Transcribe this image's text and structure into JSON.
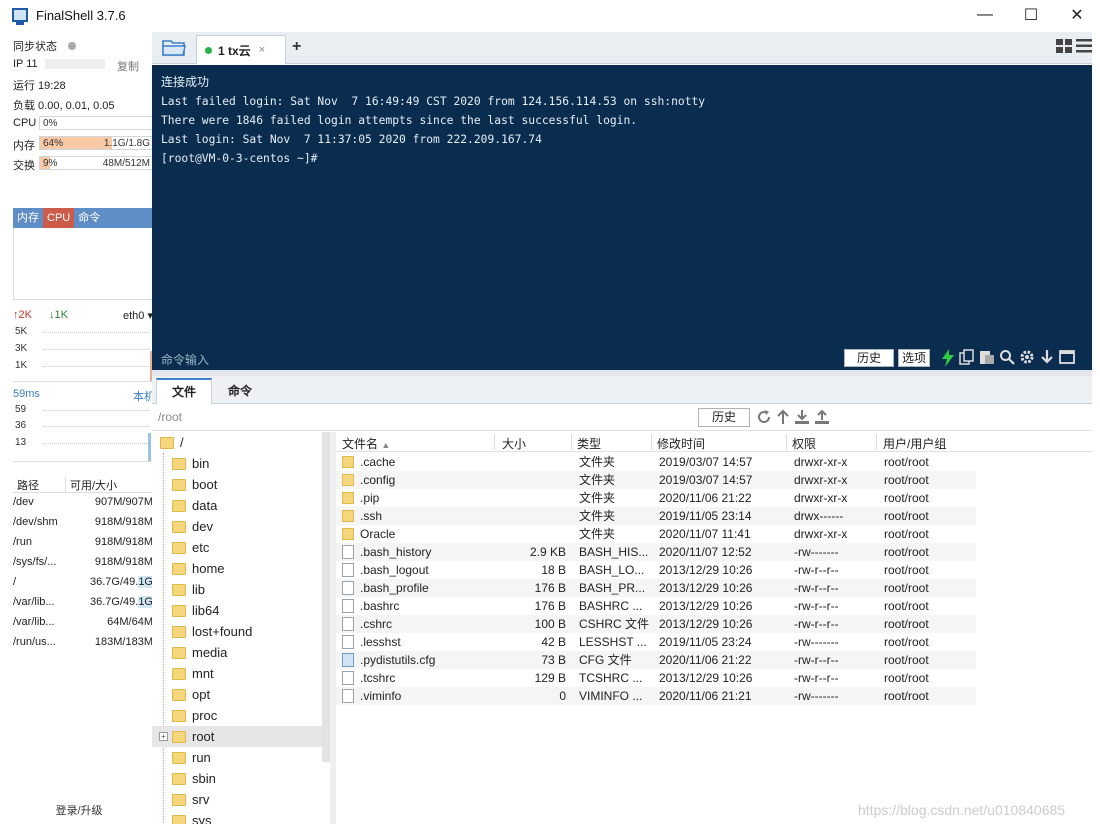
{
  "window": {
    "title": "FinalShell 3.7.6",
    "controls": {
      "minimize": "—",
      "maximize": "☐",
      "close": "✕"
    }
  },
  "sidebar": {
    "sync_label": "同步状态",
    "ip_label": "IP 11",
    "copy_label": "复制",
    "uptime": "运行 19:28",
    "load": "负载 0.00, 0.01, 0.05",
    "cpu": {
      "label": "CPU",
      "value": "0%",
      "level": 0
    },
    "mem": {
      "label": "内存",
      "value": "64%",
      "right": "1.1G/1.8G",
      "level": 0.64
    },
    "swap": {
      "label": "交换",
      "value": "9%",
      "right": "48M/512M",
      "level": 0.09
    },
    "proc_tabs": [
      "内存",
      "CPU",
      "命令"
    ],
    "net": {
      "up": "↑2K",
      "down": "↓1K",
      "iface": "eth0",
      "ticks": [
        "5K",
        "3K",
        "1K"
      ]
    },
    "ping": {
      "latency": "59ms",
      "target": "本机",
      "ticks": [
        "59",
        "36",
        "13"
      ]
    },
    "disk_headers": {
      "path": "路径",
      "avail": "可用/大小"
    },
    "disks": [
      {
        "path": "/dev",
        "size": "907M/907M",
        "used": 0
      },
      {
        "path": "/dev/shm",
        "size": "918M/918M",
        "used": 0
      },
      {
        "path": "/run",
        "size": "918M/918M",
        "used": 0
      },
      {
        "path": "/sys/fs/...",
        "size": "918M/918M",
        "used": 0
      },
      {
        "path": "/",
        "size": "36.7G/49.1G",
        "used": 0.25
      },
      {
        "path": "/var/lib...",
        "size": "36.7G/49.1G",
        "used": 0.25
      },
      {
        "path": "/var/lib...",
        "size": "64M/64M",
        "used": 0
      },
      {
        "path": "/run/us...",
        "size": "183M/183M",
        "used": 0
      }
    ],
    "login": "登录/升级"
  },
  "tabs": {
    "session": {
      "label": "1 tx云",
      "close": "×"
    },
    "add": "+"
  },
  "terminal": {
    "lines": [
      "连接成功",
      "Last failed login: Sat Nov  7 16:49:49 CST 2020 from 124.156.114.53 on ssh:notty",
      "There were 1846 failed login attempts since the last successful login.",
      "Last login: Sat Nov  7 11:37:05 2020 from 222.209.167.74",
      "[root@VM-0-3-centos ~]#"
    ],
    "cmd_placeholder": "命令输入",
    "history_btn": "历史",
    "options_btn": "选项"
  },
  "lower_tabs": [
    "文件",
    "命令"
  ],
  "pathbar": {
    "path": "/root",
    "history_btn": "历史"
  },
  "tree": {
    "root": "/",
    "items": [
      "bin",
      "boot",
      "data",
      "dev",
      "etc",
      "home",
      "lib",
      "lib64",
      "lost+found",
      "media",
      "mnt",
      "opt",
      "proc",
      "root",
      "run",
      "sbin",
      "srv",
      "sys"
    ],
    "selected": "root"
  },
  "files": {
    "headers": [
      "文件名",
      "大小",
      "类型",
      "修改时间",
      "权限",
      "用户/用户组"
    ],
    "rows": [
      {
        "name": ".cache",
        "size": "",
        "type": "文件夹",
        "mtime": "2019/03/07 14:57",
        "perm": "drwxr-xr-x",
        "owner": "root/root",
        "icon": "folder"
      },
      {
        "name": ".config",
        "size": "",
        "type": "文件夹",
        "mtime": "2019/03/07 14:57",
        "perm": "drwxr-xr-x",
        "owner": "root/root",
        "icon": "folder"
      },
      {
        "name": ".pip",
        "size": "",
        "type": "文件夹",
        "mtime": "2020/11/06 21:22",
        "perm": "drwxr-xr-x",
        "owner": "root/root",
        "icon": "folder"
      },
      {
        "name": ".ssh",
        "size": "",
        "type": "文件夹",
        "mtime": "2019/11/05 23:14",
        "perm": "drwx------",
        "owner": "root/root",
        "icon": "folder"
      },
      {
        "name": "Oracle",
        "size": "",
        "type": "文件夹",
        "mtime": "2020/11/07 11:41",
        "perm": "drwxr-xr-x",
        "owner": "root/root",
        "icon": "folder"
      },
      {
        "name": ".bash_history",
        "size": "2.9 KB",
        "type": "BASH_HIS...",
        "mtime": "2020/11/07 12:52",
        "perm": "-rw-------",
        "owner": "root/root",
        "icon": "file"
      },
      {
        "name": ".bash_logout",
        "size": "18 B",
        "type": "BASH_LO...",
        "mtime": "2013/12/29 10:26",
        "perm": "-rw-r--r--",
        "owner": "root/root",
        "icon": "file"
      },
      {
        "name": ".bash_profile",
        "size": "176 B",
        "type": "BASH_PR...",
        "mtime": "2013/12/29 10:26",
        "perm": "-rw-r--r--",
        "owner": "root/root",
        "icon": "file"
      },
      {
        "name": ".bashrc",
        "size": "176 B",
        "type": "BASHRC ...",
        "mtime": "2013/12/29 10:26",
        "perm": "-rw-r--r--",
        "owner": "root/root",
        "icon": "file"
      },
      {
        "name": ".cshrc",
        "size": "100 B",
        "type": "CSHRC 文件",
        "mtime": "2013/12/29 10:26",
        "perm": "-rw-r--r--",
        "owner": "root/root",
        "icon": "file"
      },
      {
        "name": ".lesshst",
        "size": "42 B",
        "type": "LESSHST ...",
        "mtime": "2019/11/05 23:24",
        "perm": "-rw-------",
        "owner": "root/root",
        "icon": "file"
      },
      {
        "name": ".pydistutils.cfg",
        "size": "73 B",
        "type": "CFG 文件",
        "mtime": "2020/11/06 21:22",
        "perm": "-rw-r--r--",
        "owner": "root/root",
        "icon": "cfg"
      },
      {
        "name": ".tcshrc",
        "size": "129 B",
        "type": "TCSHRC ...",
        "mtime": "2013/12/29 10:26",
        "perm": "-rw-r--r--",
        "owner": "root/root",
        "icon": "file"
      },
      {
        "name": ".viminfo",
        "size": "0",
        "type": "VIMINFO ...",
        "mtime": "2020/11/06 21:21",
        "perm": "-rw-------",
        "owner": "root/root",
        "icon": "file"
      }
    ]
  },
  "watermark": "https://blog.csdn.net/u010840685"
}
